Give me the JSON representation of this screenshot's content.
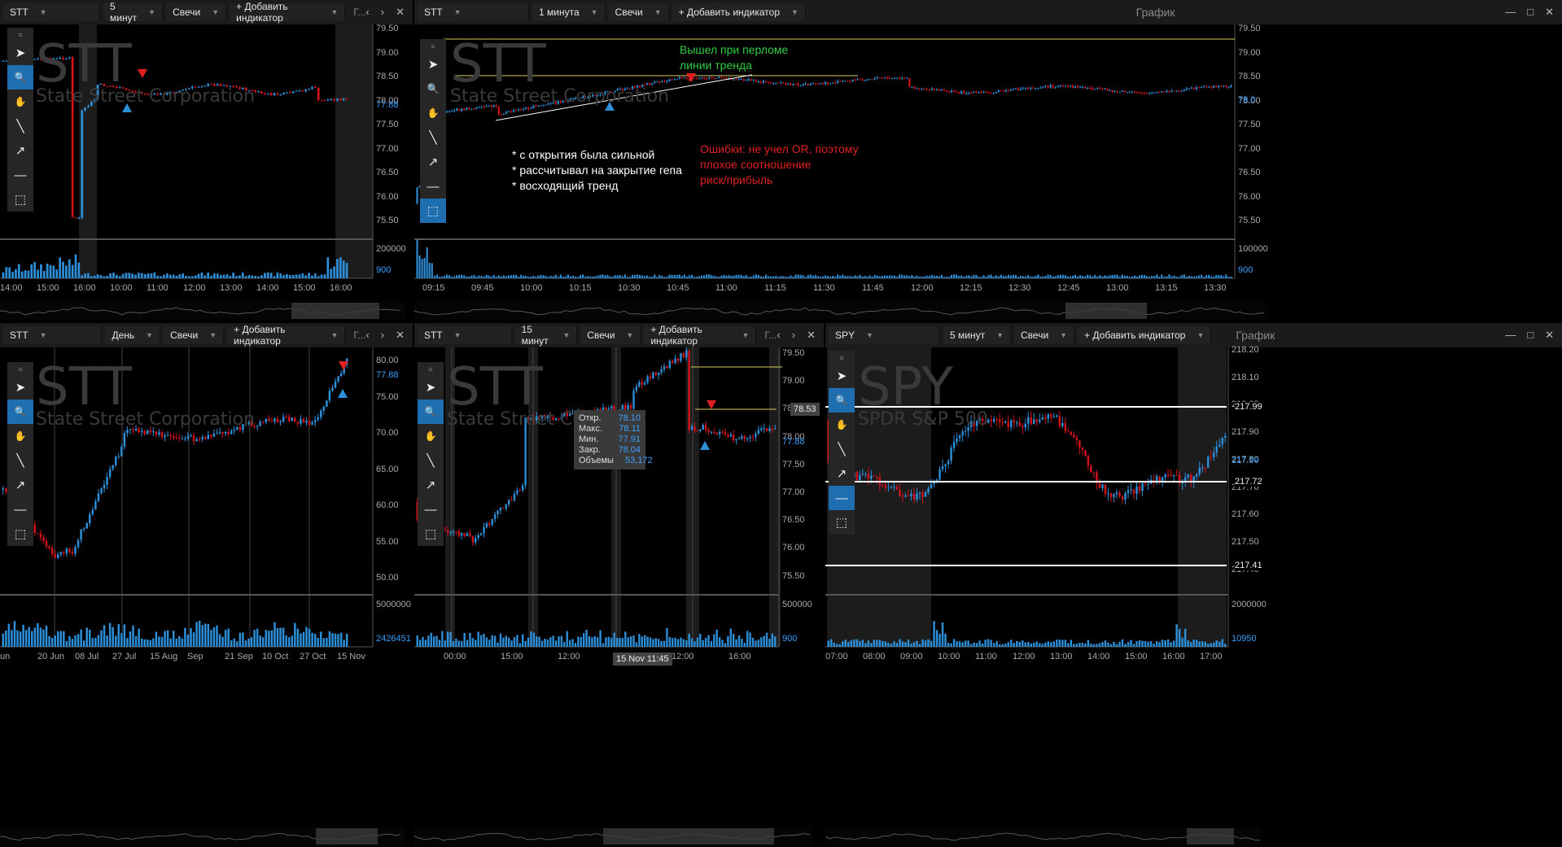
{
  "colors": {
    "up": "#2d8fd8",
    "down": "#d2121a",
    "annotation_green": "#33cc44",
    "annotation_red": "#e02020",
    "trendline": "#ffffff",
    "level_yellow": "#d8d060"
  },
  "panels": {
    "p1": {
      "ticker": "STT",
      "interval": "5 минут",
      "style": "Свечи",
      "add_indicator": "+ Добавить индикатор",
      "title": "Г...",
      "watermark": "STT",
      "company": "State Street Corporation",
      "price_ticks": [
        "79.50",
        "79.00",
        "78.50",
        "78.00",
        "77.50",
        "77.00",
        "76.50",
        "76.00",
        "75.50"
      ],
      "last_price": "77.88",
      "vol_ticks": [
        "200000",
        "900"
      ],
      "time_ticks": [
        "14:00",
        "15:00",
        "16:00",
        "10:00",
        "11:00",
        "12:00",
        "13:00",
        "14:00",
        "15:00",
        "16:00"
      ]
    },
    "p2": {
      "ticker": "STT",
      "interval": "1 минута",
      "style": "Свечи",
      "add_indicator": "+ Добавить индикатор",
      "title": "График",
      "watermark": "STT",
      "company": "State Street Corporation",
      "price_ticks": [
        "79.50",
        "79.00",
        "78.50",
        "78.00",
        "77.50",
        "77.00",
        "76.50",
        "76.00",
        "75.50"
      ],
      "last_price": "78.0",
      "vol_ticks": [
        "100000",
        "900"
      ],
      "time_ticks": [
        "09:15",
        "09:45",
        "10:00",
        "10:15",
        "10:30",
        "10:45",
        "11:00",
        "11:15",
        "11:30",
        "11:45",
        "12:00",
        "12:15",
        "12:30",
        "12:45",
        "13:00",
        "13:15",
        "13:30"
      ],
      "annotation_green": [
        "Вышел при перломе",
        "линии тренда"
      ],
      "annotation_white": [
        "* с открытия была сильной",
        "* рассчитывал на закрытие гепа",
        "* восходящий тренд"
      ],
      "annotation_red": [
        "Ошибки: не учел OR, поэтому",
        "плохое соотношение",
        "риск/прибыль"
      ]
    },
    "p3": {
      "ticker": "STT",
      "interval": "День",
      "style": "Свечи",
      "add_indicator": "+ Добавить индикатор",
      "title": "Г...",
      "watermark": "STT",
      "company": "State Street Corporation",
      "price_ticks": [
        "80.00",
        "75.00",
        "70.00",
        "65.00",
        "60.00",
        "55.00",
        "50.00"
      ],
      "last_price": "77.88",
      "vol_ticks": [
        "5000000",
        "2426451"
      ],
      "time_ticks": [
        "un",
        "20 Jun",
        "08 Jul",
        "27 Jul",
        "15 Aug",
        "Sep",
        "21 Sep",
        "10 Oct",
        "27 Oct",
        "15 Nov"
      ]
    },
    "p4": {
      "ticker": "STT",
      "interval": "15 минут",
      "style": "Свечи",
      "add_indicator": "+ Добавить индикатор",
      "title": "Г...",
      "watermark": "STT",
      "company": "State Street Corp",
      "price_ticks": [
        "79.50",
        "79.00",
        "78.50",
        "78.00",
        "77.50",
        "77.00",
        "76.50",
        "76.00",
        "75.50"
      ],
      "last_price": "77.88",
      "marker_price": "78.53",
      "vol_ticks": [
        "500000",
        "900"
      ],
      "time_ticks": [
        "00:00",
        "15:00",
        "12:00",
        "15:00",
        "12:00",
        "16:00"
      ],
      "time_badge": "15 Nov 11:45",
      "tooltip": {
        "open_label": "Откр.",
        "open": "78.10",
        "high_label": "Макс.",
        "high": "78.11",
        "low_label": "Мин.",
        "low": "77.91",
        "close_label": "Закр.",
        "close": "78.04",
        "vol_label": "Объемы",
        "vol": "53,172"
      }
    },
    "p5": {
      "ticker": "SPY",
      "interval": "5 минут",
      "style": "Свечи",
      "add_indicator": "+ Добавить индикатор",
      "title": "График",
      "watermark": "SPY",
      "company": "SPDR S&P 500",
      "price_ticks": [
        "218.20",
        "218.10",
        "218.00",
        "217.90",
        "217.80",
        "217.70",
        "217.60",
        "217.50",
        "217.40"
      ],
      "levels": [
        "217.99",
        "217.72",
        "217.41"
      ],
      "last_price": "217.99",
      "vol_ticks": [
        "2000000",
        "10950"
      ],
      "time_ticks": [
        "07:00",
        "08:00",
        "09:00",
        "10:00",
        "11:00",
        "12:00",
        "13:00",
        "14:00",
        "15:00",
        "16:00",
        "17:00"
      ]
    }
  },
  "tools": [
    "cursor-icon",
    "zoom-icon",
    "hand-icon",
    "line-icon",
    "arrow-icon",
    "hline-icon",
    "rect-icon"
  ],
  "ctrls": [
    "‹",
    "›",
    "✕"
  ]
}
